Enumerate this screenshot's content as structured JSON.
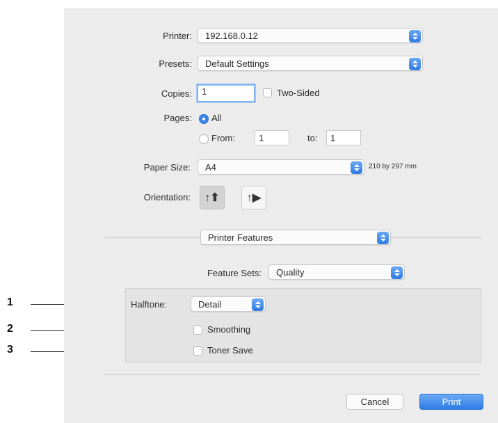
{
  "printer": {
    "label": "Printer:",
    "value": "192.168.0.12"
  },
  "presets": {
    "label": "Presets:",
    "value": "Default Settings"
  },
  "copies": {
    "label": "Copies:",
    "value": "1",
    "two_sided_label": "Two-Sided"
  },
  "pages": {
    "label": "Pages:",
    "all_label": "All",
    "from_label": "From:",
    "from_value": "1",
    "to_label": "to:",
    "to_value": "1"
  },
  "paper_size": {
    "label": "Paper Size:",
    "value": "A4",
    "dimensions": "210 by 297 mm"
  },
  "orientation": {
    "label": "Orientation:",
    "portrait_glyph": "↑⬆",
    "landscape_glyph": "↑▶"
  },
  "section_menu": {
    "value": "Printer Features"
  },
  "feature_sets": {
    "label": "Feature Sets:",
    "value": "Quality"
  },
  "halftone": {
    "label": "Halftone:",
    "value": "Detail"
  },
  "smoothing": {
    "label": "Smoothing"
  },
  "toner_save": {
    "label": "Toner Save"
  },
  "buttons": {
    "cancel": "Cancel",
    "print": "Print"
  },
  "callouts": [
    "1",
    "2",
    "3"
  ],
  "colors": {
    "accent": "#3b86ea",
    "dialog_bg": "#ececec"
  }
}
